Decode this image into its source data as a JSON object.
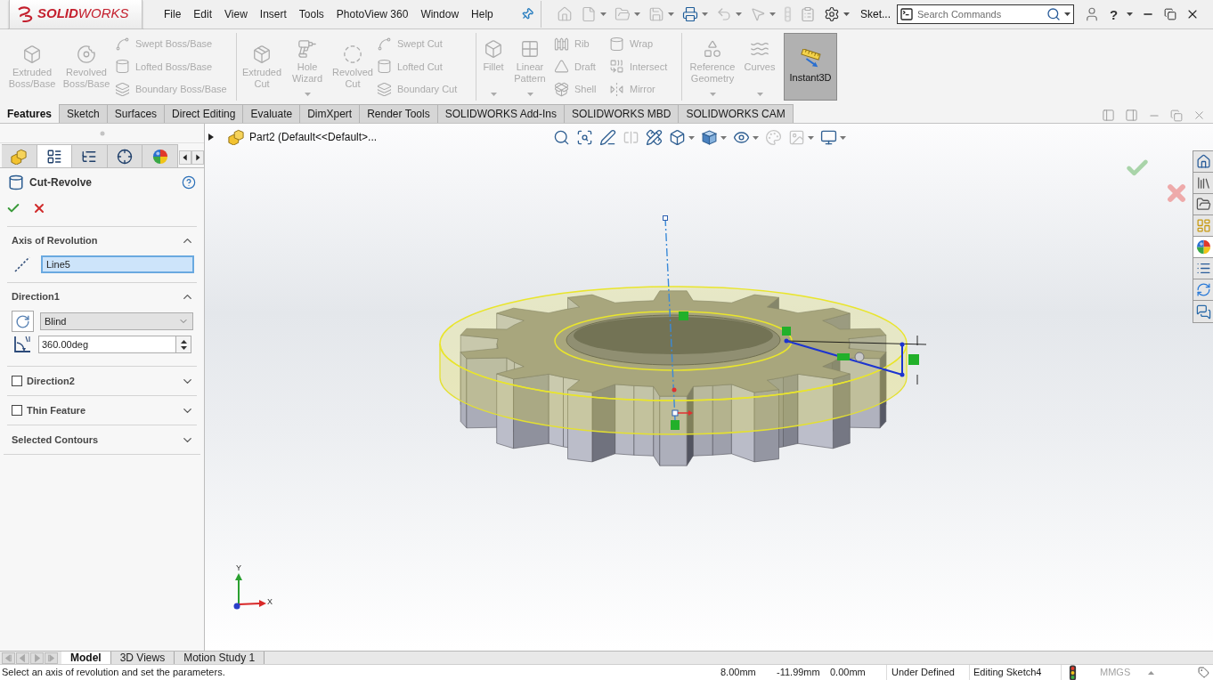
{
  "title_bar": {
    "logo": "**SOLID**WORKS",
    "menu": [
      "File",
      "Edit",
      "View",
      "Insert",
      "Tools",
      "PhotoView 360",
      "Window",
      "Help"
    ],
    "document": "Sket...",
    "search": {
      "placeholder": "Search Commands"
    },
    "help": "?"
  },
  "ribbon": {
    "groups": [
      {
        "items": [
          {
            "kind": "large",
            "label": "Extruded Boss/Base",
            "disabled": true
          },
          {
            "kind": "large",
            "label": "Revolved Boss/Base",
            "disabled": true
          },
          {
            "kind": "stack",
            "entries": [
              {
                "label": "Swept Boss/Base",
                "disabled": true
              },
              {
                "label": "Lofted Boss/Base",
                "disabled": true
              },
              {
                "label": "Boundary Boss/Base",
                "disabled": true
              }
            ]
          }
        ]
      },
      {
        "items": [
          {
            "kind": "large",
            "label": "Extruded Cut",
            "disabled": true
          },
          {
            "kind": "large",
            "label": "Hole Wizard",
            "disabled": true,
            "caret": true
          },
          {
            "kind": "large",
            "label": "Revolved Cut",
            "disabled": true
          },
          {
            "kind": "stack",
            "entries": [
              {
                "label": "Swept Cut",
                "disabled": true
              },
              {
                "label": "Lofted Cut",
                "disabled": true
              },
              {
                "label": "Boundary Cut",
                "disabled": true
              }
            ]
          }
        ]
      },
      {
        "items": [
          {
            "kind": "large",
            "label": "Fillet",
            "disabled": true,
            "caret": true
          },
          {
            "kind": "large",
            "label": "Linear Pattern",
            "disabled": true,
            "caret": true
          },
          {
            "kind": "stack",
            "entries": [
              {
                "label": "Rib",
                "disabled": true
              },
              {
                "label": "Draft",
                "disabled": true
              },
              {
                "label": "Shell",
                "disabled": true
              }
            ]
          },
          {
            "kind": "stack",
            "entries": [
              {
                "label": "Wrap",
                "disabled": true
              },
              {
                "label": "Intersect",
                "disabled": true
              },
              {
                "label": "Mirror",
                "disabled": true
              }
            ]
          }
        ]
      },
      {
        "items": [
          {
            "kind": "large",
            "label": "Reference Geometry",
            "disabled": true,
            "caret": true
          },
          {
            "kind": "large",
            "label": "Curves",
            "disabled": true,
            "caret": true
          },
          {
            "kind": "toggle",
            "label": "Instant3D",
            "disabled": false,
            "on": true
          }
        ]
      }
    ]
  },
  "tabs": [
    {
      "label": "Features",
      "selected": true
    },
    {
      "label": "Sketch",
      "selected": false
    },
    {
      "label": "Surfaces",
      "selected": false
    },
    {
      "label": "Direct Editing",
      "selected": false
    },
    {
      "label": "Evaluate",
      "selected": false
    },
    {
      "label": "DimXpert",
      "selected": false
    },
    {
      "label": "Render Tools",
      "selected": false
    },
    {
      "label": "SOLIDWORKS Add-Ins",
      "selected": false
    },
    {
      "label": "SOLIDWORKS MBD",
      "selected": false
    },
    {
      "label": "SOLIDWORKS CAM",
      "selected": false
    }
  ],
  "property_manager": {
    "tabs": [
      {
        "selected": false
      },
      {
        "selected": true
      },
      {
        "selected": false
      },
      {
        "selected": false
      },
      {
        "selected": false
      }
    ],
    "title": "Cut-Revolve",
    "sections": [
      {
        "kind": "axis",
        "title": "Axis of Revolution",
        "expanded": true,
        "value": "Line5",
        "focused": true
      },
      {
        "kind": "direction",
        "title": "Direction1",
        "expanded": true,
        "end_condition": "Blind",
        "angle": "360.00deg"
      },
      {
        "kind": "optional",
        "title": "Direction2",
        "checked": false,
        "expanded": false
      },
      {
        "kind": "optional",
        "title": "Thin Feature",
        "checked": false,
        "expanded": false
      },
      {
        "kind": "plain",
        "title": "Selected Contours",
        "expanded": false
      }
    ]
  },
  "viewport": {
    "tree_flyout": {
      "label": "Part2 (Default<<Default>...",
      "expanded": false
    },
    "triad": {
      "y_label": "Y",
      "x_label": "X"
    }
  },
  "bottom_tabs": [
    {
      "label": "Model",
      "selected": true
    },
    {
      "label": "3D Views",
      "selected": false
    },
    {
      "label": "Motion Study 1",
      "selected": false
    }
  ],
  "status_bar": {
    "message": "Select an axis of revolution and set the parameters.",
    "readouts": [
      "8.00mm",
      "-11.99mm",
      "0.00mm"
    ],
    "sketch_state": "Under Defined",
    "editing": "Editing Sketch4",
    "units": "MMGS"
  }
}
